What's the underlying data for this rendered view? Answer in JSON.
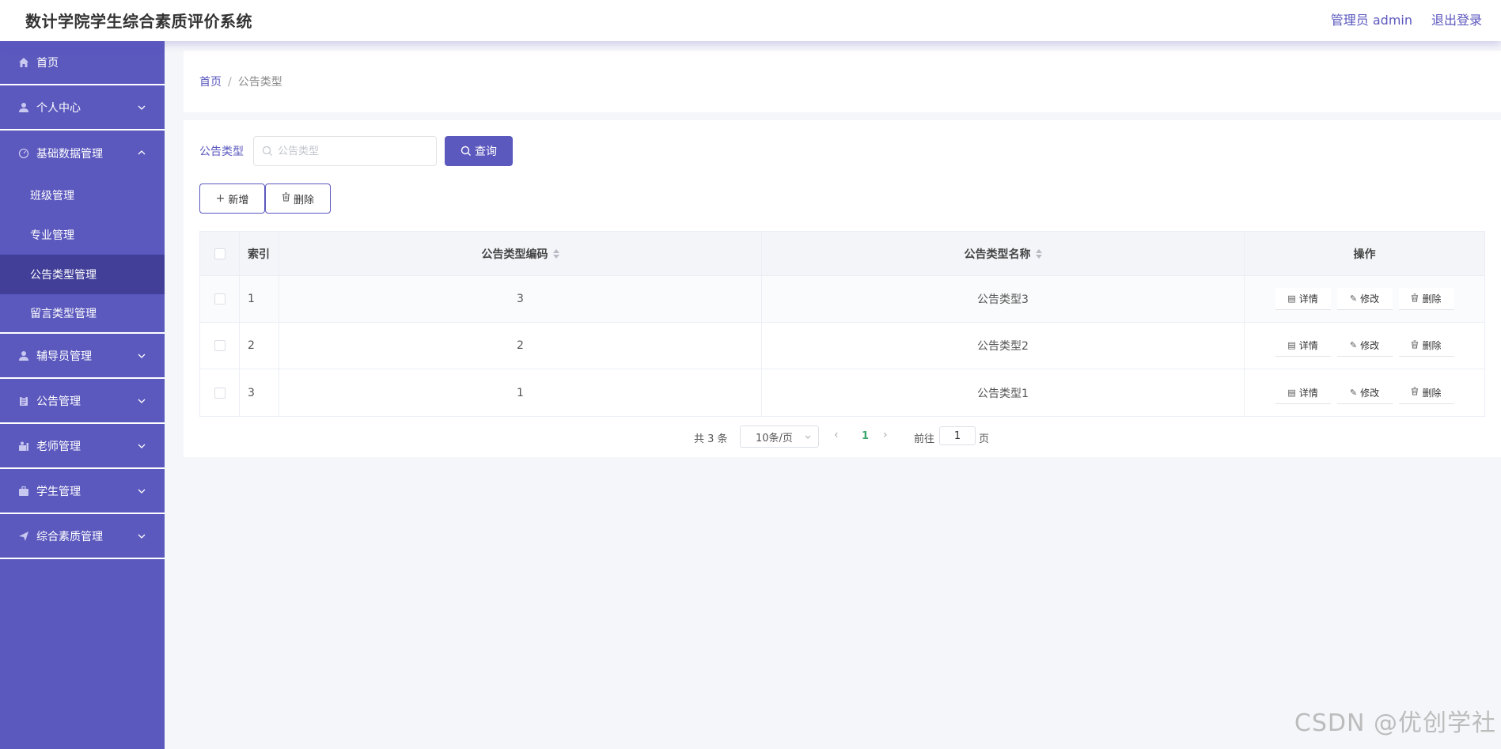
{
  "header": {
    "title": "数计学院学生综合素质评价系统",
    "user": "管理员 admin",
    "logout": "退出登录"
  },
  "sidebar": {
    "items": [
      {
        "label": "首页",
        "icon": "home-icon"
      },
      {
        "label": "个人中心",
        "icon": "user-icon"
      },
      {
        "label": "基础数据管理",
        "icon": "dashboard-icon",
        "expanded": true,
        "children": [
          "班级管理",
          "专业管理",
          "公告类型管理",
          "留言类型管理"
        ],
        "active_child": "公告类型管理"
      },
      {
        "label": "辅导员管理",
        "icon": "user-icon"
      },
      {
        "label": "公告管理",
        "icon": "clipboard-icon"
      },
      {
        "label": "老师管理",
        "icon": "teacher-icon"
      },
      {
        "label": "学生管理",
        "icon": "briefcase-icon"
      },
      {
        "label": "综合素质管理",
        "icon": "send-icon"
      }
    ]
  },
  "breadcrumb": {
    "home": "首页",
    "separator": "/",
    "current": "公告类型"
  },
  "search": {
    "label": "公告类型",
    "placeholder": "公告类型",
    "query_button": "查询"
  },
  "actions": {
    "add": "新增",
    "delete": "删除"
  },
  "table": {
    "columns": [
      "索引",
      "公告类型编码",
      "公告类型名称",
      "操作"
    ],
    "rows": [
      {
        "index": "1",
        "code": "3",
        "name": "公告类型3"
      },
      {
        "index": "2",
        "code": "2",
        "name": "公告类型2"
      },
      {
        "index": "3",
        "code": "1",
        "name": "公告类型1"
      }
    ],
    "row_actions": {
      "detail": "详情",
      "edit": "修改",
      "delete": "删除"
    }
  },
  "pagination": {
    "total": "共 3 条",
    "page_size": "10条/页",
    "current_page": "1",
    "goto_label": "前往",
    "goto_value": "1",
    "page_unit": "页"
  },
  "watermark": "CSDN @优创学社",
  "colors": {
    "primary": "#5b58be",
    "sidebar_active": "#423f99",
    "page_active": "#3aa76d"
  }
}
